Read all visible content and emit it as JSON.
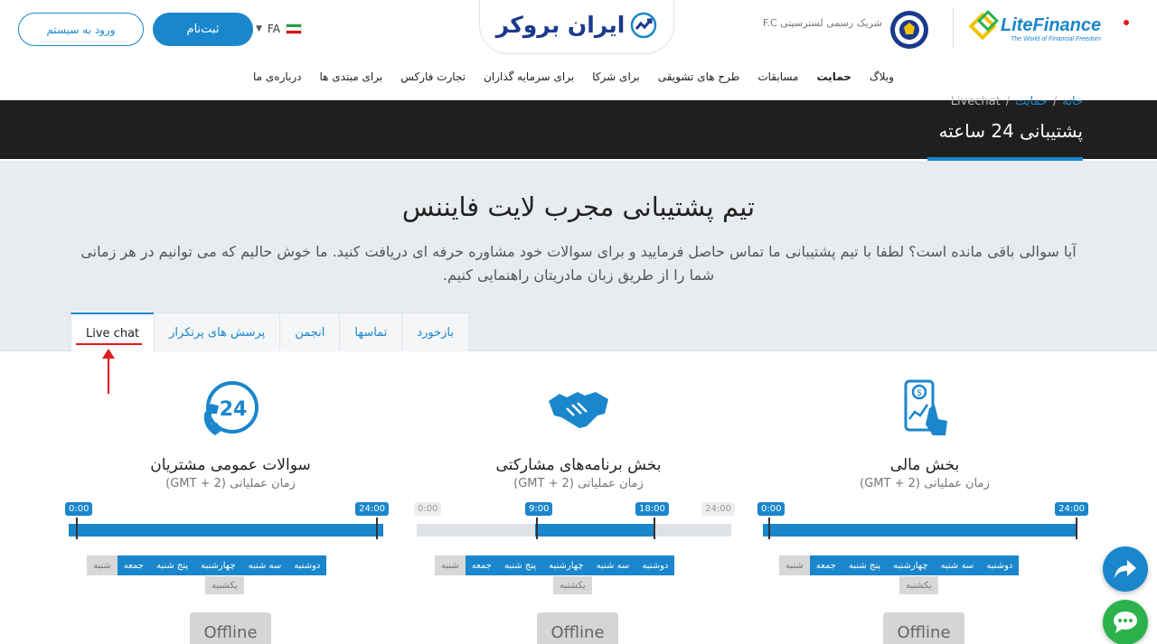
{
  "header": {
    "login_label": "ورود به سیستم",
    "register_label": "ثبت‌نام",
    "language": "FA",
    "site_logo_text": "ایران بروکر",
    "partner_text": "شریک رسمی لسترسیتی F.C",
    "brand_name": "LiteFinance",
    "brand_tagline": "The World of Financial Freedom"
  },
  "nav": {
    "items": [
      {
        "label": "درباره‌ی ما"
      },
      {
        "label": "برای مبتدی ها"
      },
      {
        "label": "تجارت فارکس"
      },
      {
        "label": "برای سرمایه گذاران"
      },
      {
        "label": "برای شرکا"
      },
      {
        "label": "طرح های تشویقی"
      },
      {
        "label": "مسابقات"
      },
      {
        "label": "حمایت"
      },
      {
        "label": "وبلاگ"
      }
    ],
    "active": "حمایت"
  },
  "banner": {
    "breadcrumb": [
      "خانه",
      "حمایت",
      "Livechat"
    ],
    "separator": "/",
    "title": "پشتیبانی 24 ساعته"
  },
  "section": {
    "title": "تیم پشتیبانی مجرب لایت فایننس",
    "description": "آیا سوالی باقی مانده است؟ لطفا با تیم پشتیبانی ما تماس حاصل فرمایید و برای سوالات خود مشاوره حرفه ای دریافت کنید. ما خوش حالیم که می توانیم در هر زمانی شما را از طریق زبان مادریتان راهنمایی کنیم."
  },
  "tabs": [
    {
      "label": "Live chat",
      "active": true
    },
    {
      "label": "پرسش های پرتکرار",
      "active": false
    },
    {
      "label": "انجمن",
      "active": false
    },
    {
      "label": "تماسها",
      "active": false
    },
    {
      "label": "بازخورد",
      "active": false
    }
  ],
  "cards": [
    {
      "icon": "24h-phone-icon",
      "title": "سوالات عمومی مشتریان",
      "subtitle": "زمان عملیاتی (GMT + 2)",
      "start_label": "0:00",
      "end_label": "24:00",
      "start_fraction": 0,
      "end_fraction": 1,
      "days_on": [
        "دوشنبه",
        "سه شنبه",
        "چهارشنبه",
        "پنج شنبه",
        "جمعه"
      ],
      "days_off": [
        "شنبه"
      ],
      "sunday": "یکشنبه",
      "status": "Offline"
    },
    {
      "icon": "handshake-icon",
      "title": "بخش برنامه‌های مشارکتی",
      "subtitle": "زمان عملیاتی (GMT + 2)",
      "start_label": "9:00",
      "end_label": "18:00",
      "range_start_label": "0:00",
      "range_end_label": "24:00",
      "start_fraction": 0.375,
      "end_fraction": 0.75,
      "days_on": [
        "دوشنبه",
        "سه شنبه",
        "چهارشنبه",
        "پنج شنبه",
        "جمعه"
      ],
      "days_off": [
        "شنبه"
      ],
      "sunday": "یکشنبه",
      "status": "Offline"
    },
    {
      "icon": "mobile-finance-icon",
      "title": "بخش مالی",
      "subtitle": "زمان عملیاتی (GMT + 2)",
      "start_label": "0:00",
      "end_label": "24:00",
      "start_fraction": 0,
      "end_fraction": 1,
      "days_on": [
        "دوشنبه",
        "سه شنبه",
        "چهارشنبه",
        "پنج شنبه",
        "جمعه"
      ],
      "days_off": [
        "شنبه"
      ],
      "sunday": "یکشنبه",
      "status": "Offline"
    }
  ],
  "colors": {
    "accent": "#1a86cc",
    "banner": "#1f1f1f",
    "annotation": "#e0191b",
    "chat_button": "#2bb24c"
  }
}
